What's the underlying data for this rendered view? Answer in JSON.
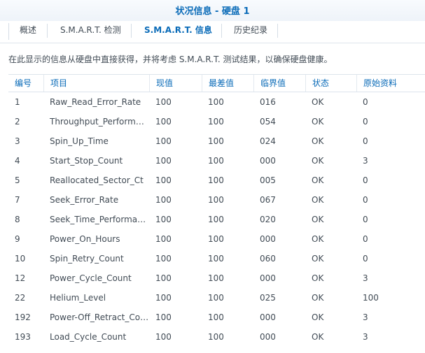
{
  "window": {
    "title": "状况信息 - 硬盘 1"
  },
  "tabs": [
    {
      "label": "概述",
      "active": false
    },
    {
      "label": "S.M.A.R.T. 检测",
      "active": false
    },
    {
      "label": "S.M.A.R.T. 信息",
      "active": true
    },
    {
      "label": "历史纪录",
      "active": false
    }
  ],
  "description": "在此显示的信息从硬盘中直接获得，并将考虑 S.M.A.R.T. 测试结果，以确保硬盘健康。",
  "table": {
    "columns": [
      "编号",
      "项目",
      "现值",
      "最差值",
      "临界值",
      "状态",
      "原始资料"
    ],
    "rows": [
      [
        "1",
        "Raw_Read_Error_Rate",
        "100",
        "100",
        "016",
        "OK",
        "0"
      ],
      [
        "2",
        "Throughput_Performance",
        "100",
        "100",
        "054",
        "OK",
        "0"
      ],
      [
        "3",
        "Spin_Up_Time",
        "100",
        "100",
        "024",
        "OK",
        "0"
      ],
      [
        "4",
        "Start_Stop_Count",
        "100",
        "100",
        "000",
        "OK",
        "3"
      ],
      [
        "5",
        "Reallocated_Sector_Ct",
        "100",
        "100",
        "005",
        "OK",
        "0"
      ],
      [
        "7",
        "Seek_Error_Rate",
        "100",
        "100",
        "067",
        "OK",
        "0"
      ],
      [
        "8",
        "Seek_Time_Performance",
        "100",
        "100",
        "020",
        "OK",
        "0"
      ],
      [
        "9",
        "Power_On_Hours",
        "100",
        "100",
        "000",
        "OK",
        "0"
      ],
      [
        "10",
        "Spin_Retry_Count",
        "100",
        "100",
        "060",
        "OK",
        "0"
      ],
      [
        "12",
        "Power_Cycle_Count",
        "100",
        "100",
        "000",
        "OK",
        "3"
      ],
      [
        "22",
        "Helium_Level",
        "100",
        "100",
        "025",
        "OK",
        "100"
      ],
      [
        "192",
        "Power-Off_Retract_Count",
        "100",
        "100",
        "000",
        "OK",
        "3"
      ],
      [
        "193",
        "Load_Cycle_Count",
        "100",
        "100",
        "000",
        "OK",
        "3"
      ]
    ]
  },
  "colors": {
    "accent": "#0a6bb8",
    "text": "#414b55",
    "border": "#dde4ec"
  }
}
